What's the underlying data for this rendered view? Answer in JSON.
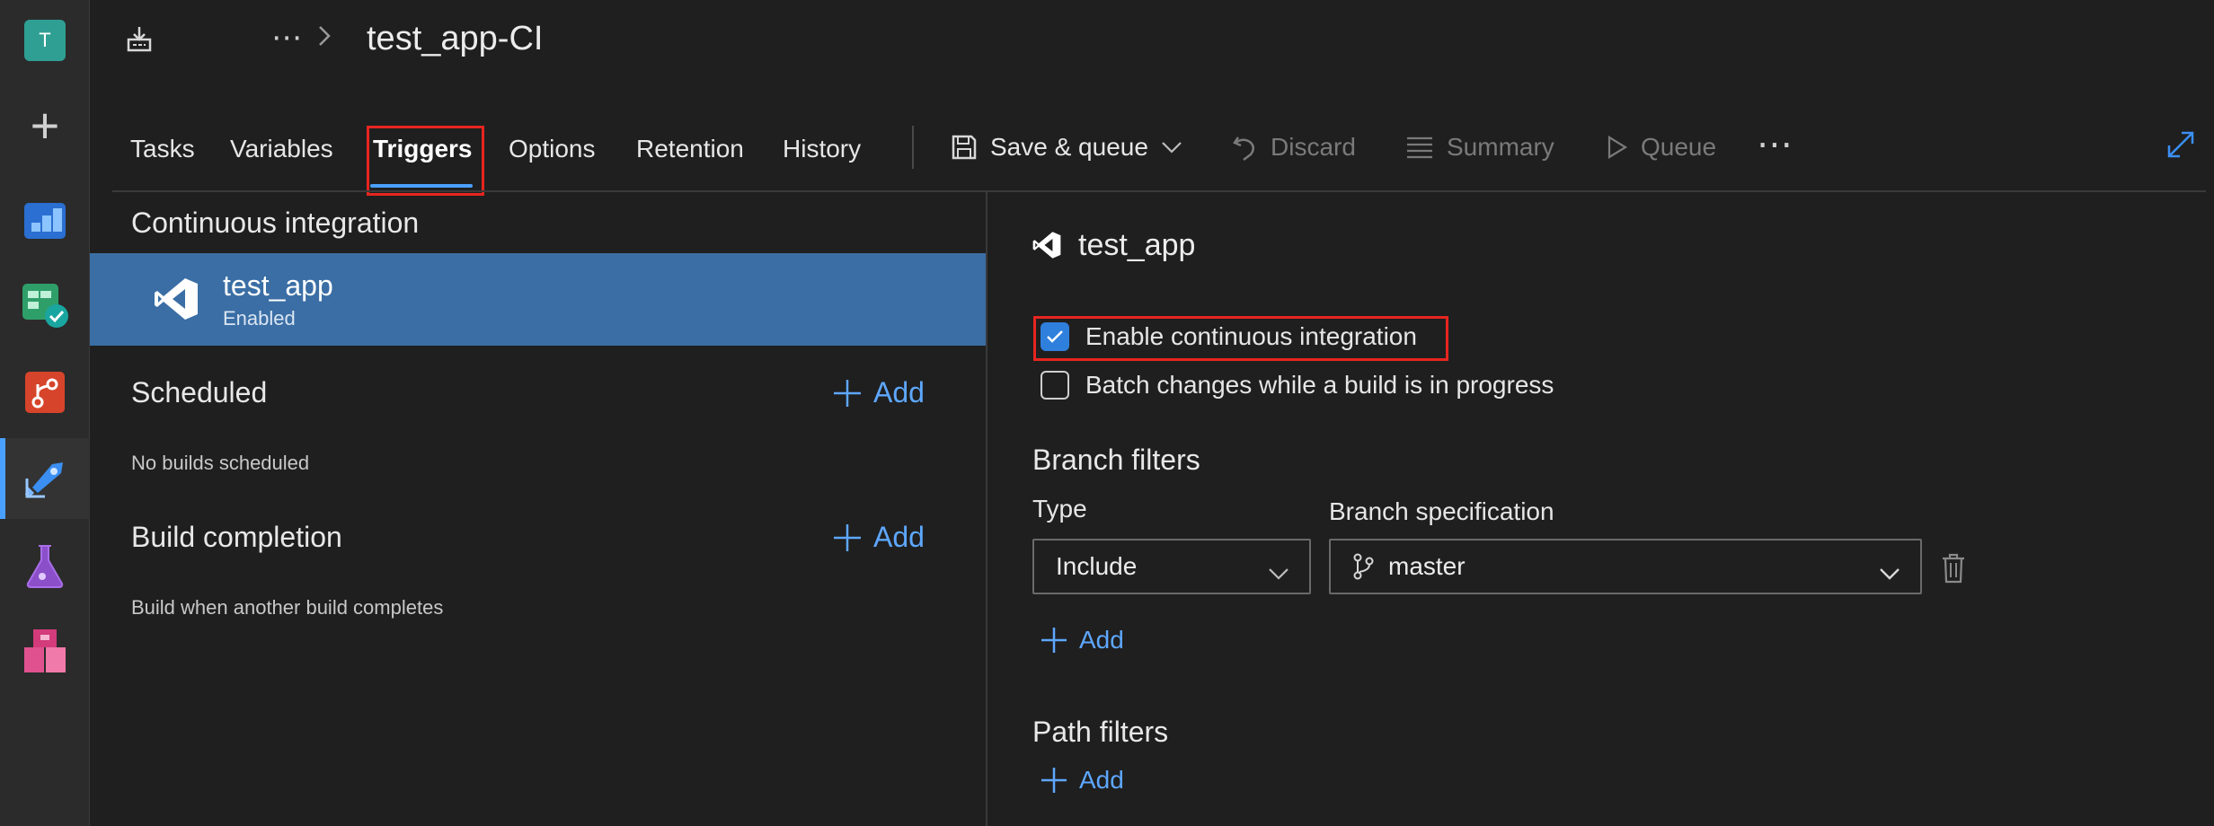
{
  "rail": {
    "org_initial": "T",
    "items": [
      {
        "name": "org-avatar"
      },
      {
        "name": "new-item"
      },
      {
        "name": "boards"
      },
      {
        "name": "test-plans-board"
      },
      {
        "name": "repos"
      },
      {
        "name": "pipelines",
        "active": true
      },
      {
        "name": "test-plans"
      },
      {
        "name": "artifacts"
      }
    ]
  },
  "header": {
    "more": "⋯",
    "title": "test_app-CI"
  },
  "tabs": [
    {
      "label": "Tasks"
    },
    {
      "label": "Variables"
    },
    {
      "label": "Triggers",
      "selected": true
    },
    {
      "label": "Options"
    },
    {
      "label": "Retention"
    },
    {
      "label": "History"
    }
  ],
  "toolbar": {
    "save_queue": "Save & queue",
    "discard": "Discard",
    "summary": "Summary",
    "queue": "Queue",
    "more": "⋯"
  },
  "left": {
    "ci_title": "Continuous integration",
    "ci_item": {
      "name": "test_app",
      "status": "Enabled"
    },
    "scheduled_title": "Scheduled",
    "scheduled_add": "Add",
    "scheduled_note": "No builds scheduled",
    "build_completion_title": "Build completion",
    "build_completion_add": "Add",
    "build_completion_note": "Build when another build completes"
  },
  "right": {
    "repo_name": "test_app",
    "enable_ci": {
      "label": "Enable continuous integration",
      "checked": true
    },
    "batch_changes": {
      "label": "Batch changes while a build is in progress",
      "checked": false
    },
    "branch_filters_title": "Branch filters",
    "type_label": "Type",
    "type_value": "Include",
    "branch_spec_label": "Branch specification",
    "branch_spec_value": "master",
    "branch_add": "Add",
    "path_filters_title": "Path filters",
    "path_add": "Add"
  },
  "colors": {
    "accent": "#4aa0ff",
    "selected_row": "#3a6ea5",
    "highlight": "#e8251f",
    "link": "#5ea7ff"
  }
}
